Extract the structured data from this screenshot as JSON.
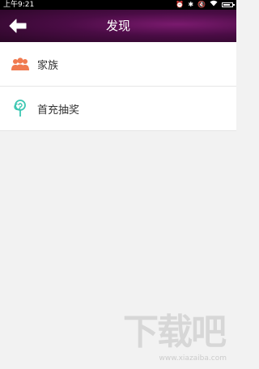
{
  "status_bar": {
    "time": "上午9:21",
    "icons": [
      "alarm-icon",
      "bluetooth-icon",
      "mute-icon",
      "wifi-icon",
      "battery-icon"
    ]
  },
  "header": {
    "title": "发现",
    "back_icon": "back-arrow-icon",
    "background_color": "#4a0c45"
  },
  "list": {
    "items": [
      {
        "label": "家族",
        "icon": "family-icon",
        "icon_color": "#f07a4f"
      },
      {
        "label": "首充抽奖",
        "icon": "lollipop-icon",
        "icon_color": "#3cc7b2"
      }
    ]
  },
  "watermark": {
    "text": "下载吧",
    "url": "www.xiazaiba.com"
  }
}
